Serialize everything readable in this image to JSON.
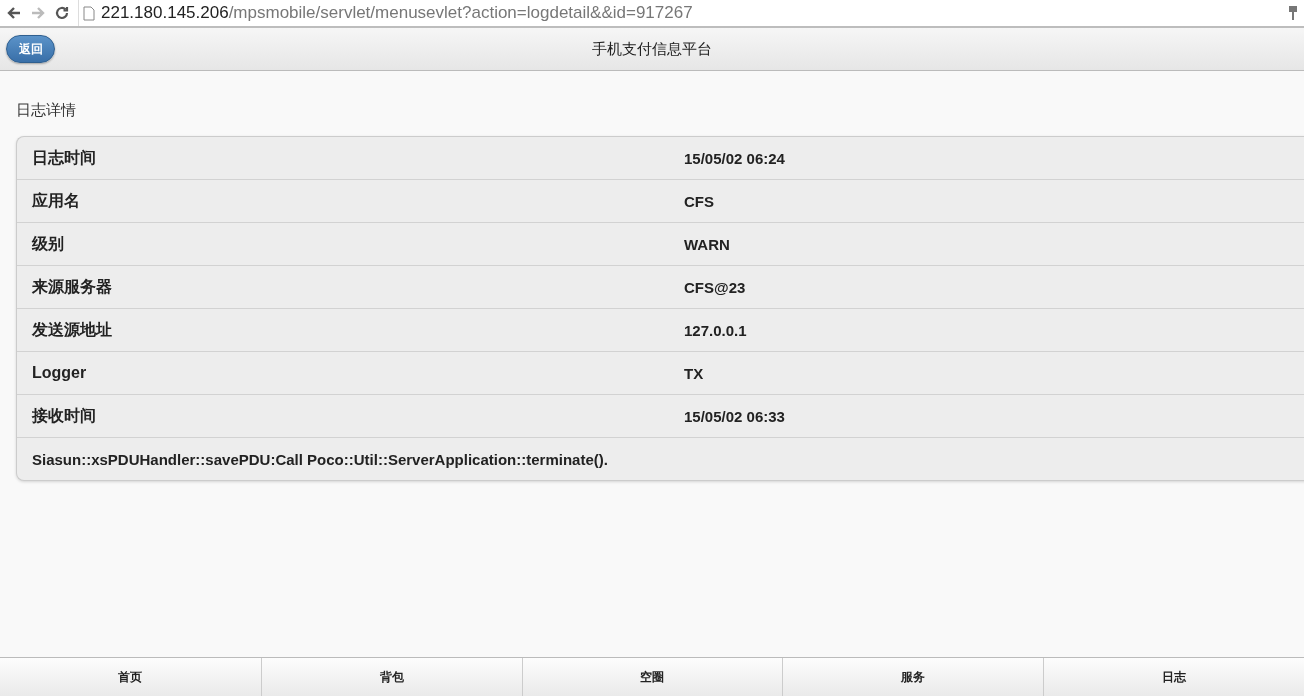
{
  "browser": {
    "back_disabled": false,
    "forward_disabled": true,
    "url_host": "221.180.145.206",
    "url_path": "/mpsmobile/servlet/menusevlet?action=logdetail&&id=917267"
  },
  "header": {
    "back_button": "返回",
    "title": "手机支付信息平台"
  },
  "section_title": "日志详情",
  "details": [
    {
      "label": "日志时间",
      "value": "15/05/02 06:24"
    },
    {
      "label": "应用名",
      "value": "CFS"
    },
    {
      "label": "级别",
      "value": "WARN"
    },
    {
      "label": "来源服务器",
      "value": "CFS@23"
    },
    {
      "label": "发送源地址",
      "value": "127.0.0.1"
    },
    {
      "label": "Logger",
      "value": "TX"
    },
    {
      "label": "接收时间",
      "value": "15/05/02 06:33"
    }
  ],
  "message": "Siasun::xsPDUHandler::savePDU:Call Poco::Util::ServerApplication::terminate().",
  "nav": [
    {
      "label": "首页"
    },
    {
      "label": "背包"
    },
    {
      "label": "空圈"
    },
    {
      "label": "服务"
    },
    {
      "label": "日志"
    }
  ]
}
